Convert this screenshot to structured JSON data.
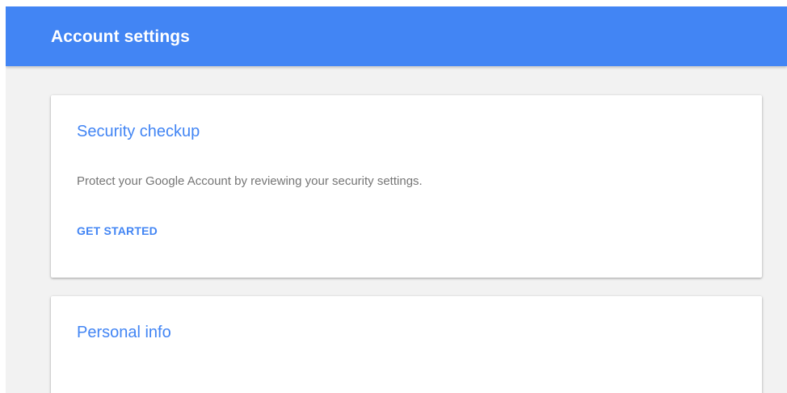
{
  "colors": {
    "app_bar": "#4285f4",
    "background": "#f2f2f2",
    "card": "#ffffff",
    "accent": "#4285f4",
    "body_text": "#757575"
  },
  "header": {
    "title": "Account settings"
  },
  "cards": [
    {
      "title": "Security checkup",
      "description": "Protect your Google Account by reviewing your security settings.",
      "action_label": "GET STARTED"
    },
    {
      "title": "Personal info"
    }
  ]
}
